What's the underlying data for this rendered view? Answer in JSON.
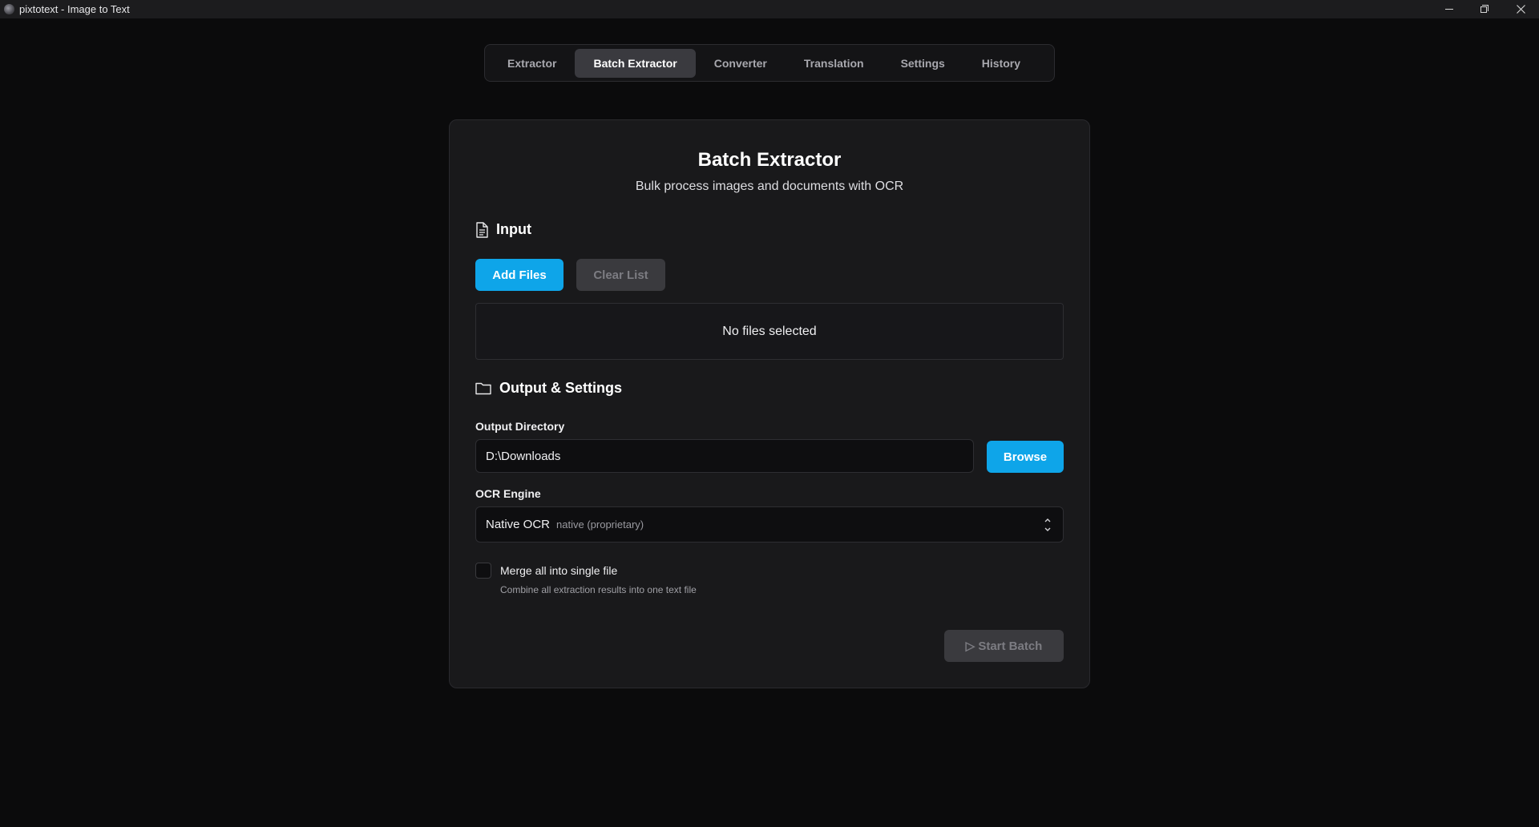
{
  "window": {
    "title": "pixtotext - Image to Text"
  },
  "nav": {
    "tabs": [
      {
        "label": "Extractor"
      },
      {
        "label": "Batch Extractor"
      },
      {
        "label": "Converter"
      },
      {
        "label": "Translation"
      },
      {
        "label": "Settings"
      },
      {
        "label": "History"
      }
    ],
    "active": "Batch Extractor"
  },
  "card": {
    "title": "Batch Extractor",
    "subtitle": "Bulk process images and documents with OCR"
  },
  "input_section": {
    "heading": "Input",
    "icon": "document-icon",
    "add_files_label": "Add Files",
    "clear_list_label": "Clear List",
    "empty_text": "No files selected"
  },
  "output_section": {
    "heading": "Output & Settings",
    "icon": "folder-icon",
    "output_dir_label": "Output Directory",
    "output_dir_value": "D:\\Downloads",
    "browse_label": "Browse",
    "ocr_engine_label": "OCR Engine",
    "ocr_engine_value": "Native OCR",
    "ocr_engine_detail": "native (proprietary)",
    "merge_label": "Merge all into single file",
    "merge_desc": "Combine all extraction results into one text file",
    "merge_checked": false
  },
  "actions": {
    "start_label": "▷ Start Batch"
  },
  "colors": {
    "accent": "#0ea5e9",
    "background": "#0b0b0c",
    "card": "#19191b"
  }
}
